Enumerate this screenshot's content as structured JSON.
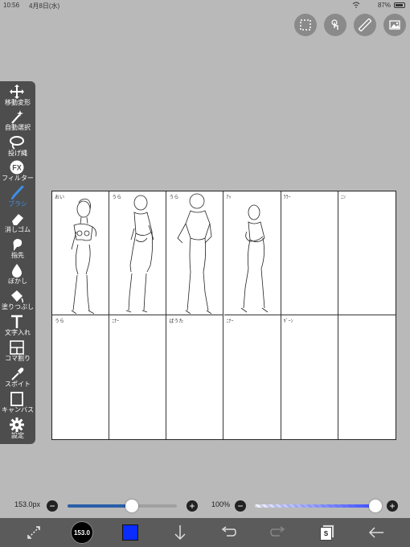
{
  "status_bar": {
    "time": "10:56",
    "date": "4月8日(水)",
    "battery": "87%"
  },
  "colors": {
    "accent": "#3d8fe8",
    "canvas_bg": "#b9b9b9",
    "brush_color": "#0a2cff",
    "opacity_fill": "#3a4cff"
  },
  "top_actions": [
    {
      "name": "selection-icon"
    },
    {
      "name": "touch-icon"
    },
    {
      "name": "ruler-icon"
    },
    {
      "name": "gallery-icon"
    }
  ],
  "toolbar": {
    "tools": [
      {
        "id": "move-transform",
        "label": "移動変形",
        "icon": "move-icon"
      },
      {
        "id": "magic-wand",
        "label": "自動選択",
        "icon": "magic-wand-icon"
      },
      {
        "id": "lasso",
        "label": "投げ縄",
        "icon": "lasso-icon"
      },
      {
        "id": "filter",
        "label": "フィルター",
        "icon": "fx-icon"
      },
      {
        "id": "brush",
        "label": "ブラシ",
        "icon": "brush-icon",
        "active": true
      },
      {
        "id": "eraser",
        "label": "消しゴム",
        "icon": "eraser-icon"
      },
      {
        "id": "finger",
        "label": "指先",
        "icon": "finger-icon"
      },
      {
        "id": "blur",
        "label": "ぼかし",
        "icon": "drop-icon"
      },
      {
        "id": "fill",
        "label": "塗りつぶし",
        "icon": "bucket-icon"
      },
      {
        "id": "text",
        "label": "文字入れ",
        "icon": "text-icon"
      },
      {
        "id": "frame-divider",
        "label": "コマ割り",
        "icon": "frame-icon"
      },
      {
        "id": "eyedropper",
        "label": "スポイト",
        "icon": "eyedropper-icon"
      },
      {
        "id": "canvas",
        "label": "キャンバス",
        "icon": "canvas-icon"
      },
      {
        "id": "settings",
        "label": "設定",
        "icon": "gear-icon"
      }
    ]
  },
  "canvas": {
    "cells": [
      {
        "label": "おい"
      },
      {
        "label": "うら"
      },
      {
        "label": "うら"
      },
      {
        "label": "ｱｯ"
      },
      {
        "label": "ﾗﾗｰ"
      },
      {
        "label": "ﾆﾝ"
      },
      {
        "label": "うら"
      },
      {
        "label": "ﾆﾅｰ"
      },
      {
        "label": "ばうた"
      },
      {
        "label": "ﾆﾅｰ"
      },
      {
        "label": "ｷﾞｰﾝ"
      },
      {
        "label": ""
      }
    ]
  },
  "brush_size": {
    "value": "153.0px",
    "level": 0.59,
    "minus": "−",
    "plus": "+"
  },
  "opacity": {
    "value": "100%",
    "level": 1.0,
    "minus": "−",
    "plus": "+"
  },
  "bottom_bar": {
    "brush_badge": "153.0",
    "layer_badge": "S",
    "items": [
      "transform-icon",
      "brush-size-badge",
      "color-swatch",
      "download-icon",
      "undo-icon",
      "redo-icon",
      "layers-icon",
      "back-icon"
    ]
  }
}
